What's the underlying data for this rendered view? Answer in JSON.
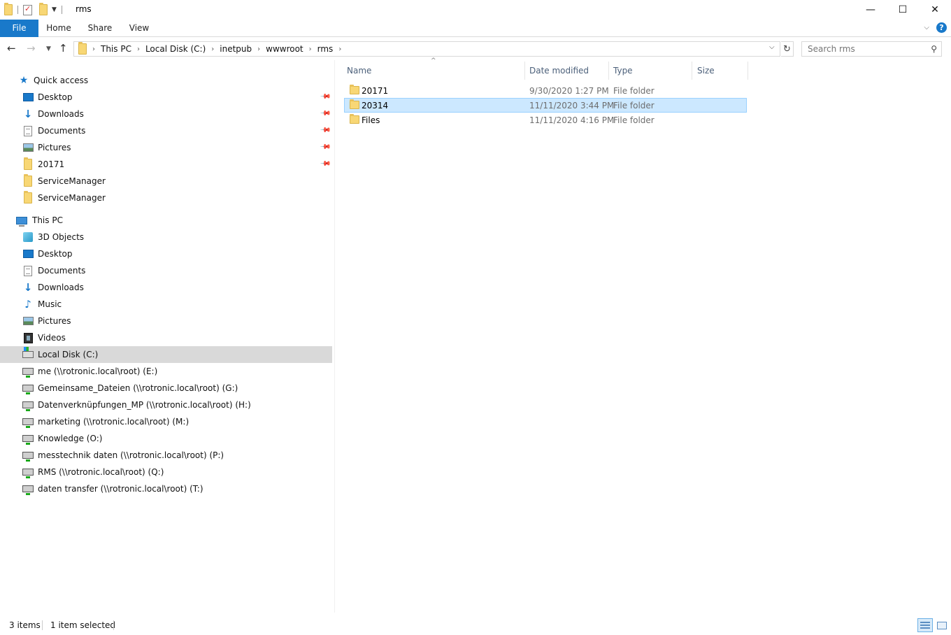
{
  "window": {
    "title": "rms",
    "minimize": "—",
    "maximize": "☐",
    "close": "✕"
  },
  "ribbon": {
    "tabs": [
      {
        "label": "File"
      },
      {
        "label": "Home"
      },
      {
        "label": "Share"
      },
      {
        "label": "View"
      }
    ],
    "help": "?",
    "accent_color": "#1979ca"
  },
  "address": {
    "crumbs": [
      "This PC",
      "Local Disk (C:)",
      "inetpub",
      "wwwroot",
      "rms"
    ],
    "search_placeholder": "Search rms"
  },
  "nav": {
    "quick_access": {
      "label": "Quick access",
      "items": [
        {
          "label": "Desktop",
          "icon": "desktop-icon",
          "pinned": true
        },
        {
          "label": "Downloads",
          "icon": "downloads-icon",
          "pinned": true
        },
        {
          "label": "Documents",
          "icon": "documents-icon",
          "pinned": true
        },
        {
          "label": "Pictures",
          "icon": "pictures-icon",
          "pinned": true
        },
        {
          "label": "20171",
          "icon": "folder-icon",
          "pinned": true
        },
        {
          "label": "ServiceManager",
          "icon": "folder-icon",
          "pinned": false
        },
        {
          "label": "ServiceManager",
          "icon": "folder-icon",
          "pinned": false
        }
      ]
    },
    "this_pc": {
      "label": "This PC",
      "items": [
        {
          "label": "3D Objects",
          "icon": "3d-objects-icon"
        },
        {
          "label": "Desktop",
          "icon": "desktop-icon"
        },
        {
          "label": "Documents",
          "icon": "documents-icon"
        },
        {
          "label": "Downloads",
          "icon": "downloads-icon"
        },
        {
          "label": "Music",
          "icon": "music-icon"
        },
        {
          "label": "Pictures",
          "icon": "pictures-icon"
        },
        {
          "label": "Videos",
          "icon": "videos-icon"
        },
        {
          "label": "Local Disk (C:)",
          "icon": "local-disk-icon",
          "selected": true
        },
        {
          "label": "me (\\\\rotronic.local\\root) (E:)",
          "icon": "network-drive-icon"
        },
        {
          "label": "Gemeinsame_Dateien (\\\\rotronic.local\\root) (G:)",
          "icon": "network-drive-icon"
        },
        {
          "label": "Datenverknüpfungen_MP (\\\\rotronic.local\\root) (H:)",
          "icon": "network-drive-icon"
        },
        {
          "label": "marketing (\\\\rotronic.local\\root) (M:)",
          "icon": "network-drive-icon"
        },
        {
          "label": "Knowledge (O:)",
          "icon": "network-drive-icon"
        },
        {
          "label": "messtechnik daten (\\\\rotronic.local\\root) (P:)",
          "icon": "network-drive-icon"
        },
        {
          "label": "RMS (\\\\rotronic.local\\root) (Q:)",
          "icon": "network-drive-icon"
        },
        {
          "label": "daten transfer (\\\\rotronic.local\\root) (T:)",
          "icon": "network-drive-icon"
        }
      ]
    }
  },
  "files": {
    "columns": [
      "Name",
      "Date modified",
      "Type",
      "Size"
    ],
    "rows": [
      {
        "name": "20171",
        "date": "9/30/2020 1:27 PM",
        "type": "File folder",
        "selected": false
      },
      {
        "name": "20314",
        "date": "11/11/2020 3:44 PM",
        "type": "File folder",
        "selected": true
      },
      {
        "name": "Files",
        "date": "11/11/2020 4:16 PM",
        "type": "File folder",
        "selected": false
      }
    ]
  },
  "status": {
    "count": "3 items",
    "selection": "1 item selected"
  }
}
